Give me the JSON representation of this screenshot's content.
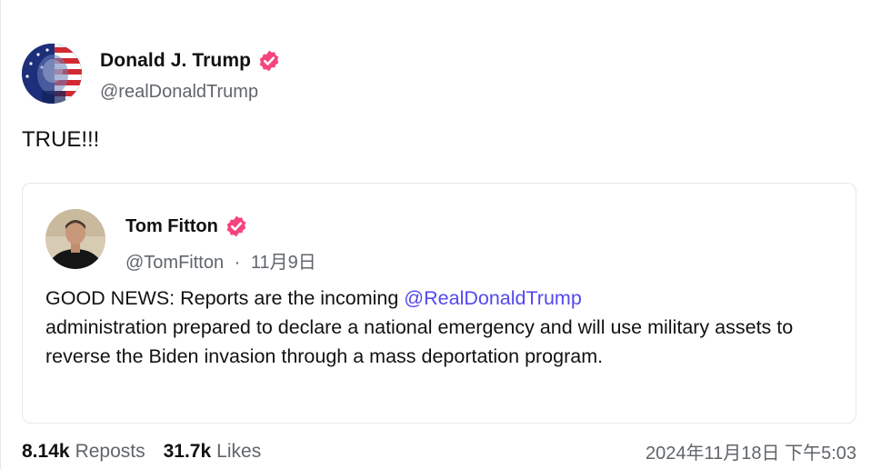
{
  "post": {
    "author": {
      "display_name": "Donald J. Trump",
      "handle": "@realDonaldTrump",
      "verified": true
    },
    "text": "TRUE!!!",
    "quoted_post": {
      "author": {
        "display_name": "Tom Fitton",
        "handle": "@TomFitton",
        "separator": "·",
        "date": "11月9日",
        "verified": true
      },
      "text_before_mention": "GOOD NEWS: Reports are the incoming ",
      "mention": "@RealDonaldTrump",
      "text_after_mention": " administration prepared to declare a national emergency and will use military assets to reverse the Biden invasion through a mass deportation program."
    },
    "stats": {
      "reposts_count": "8.14k",
      "reposts_label": "Reposts",
      "likes_count": "31.7k",
      "likes_label": "Likes"
    },
    "timestamp": "2024年11月18日 下午5:03"
  },
  "colors": {
    "verified_badge": "#f5457c",
    "mention": "#5448ee",
    "secondary_text": "#60656b"
  },
  "icons": {
    "verified": "verified-badge-icon"
  }
}
